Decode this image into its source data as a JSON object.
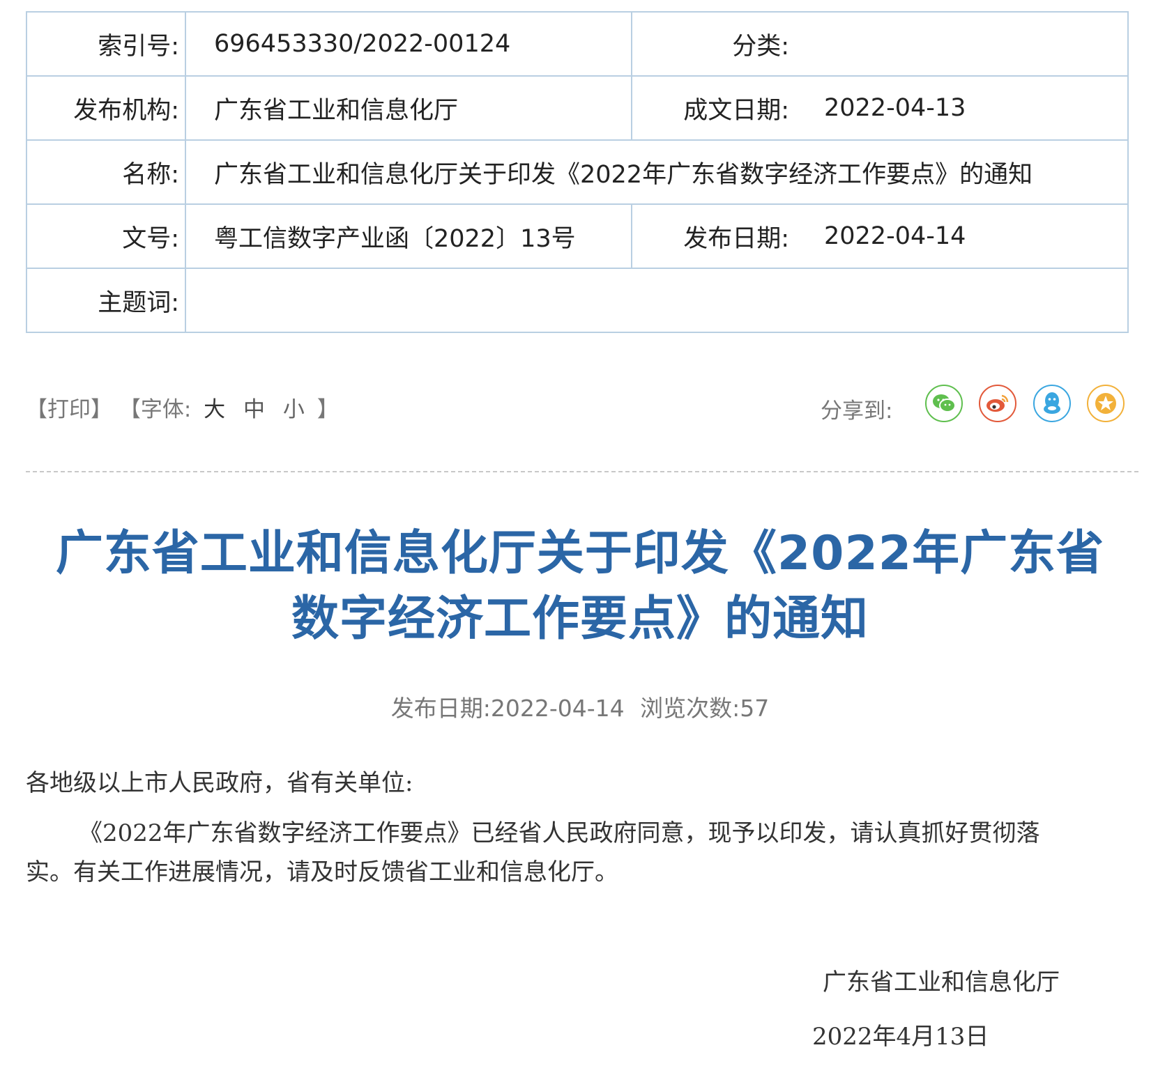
{
  "meta": {
    "index_label": "索引号:",
    "index_value": "696453330/2022-00124",
    "category_label": "分类:",
    "category_value": "",
    "issuer_label": "发布机构:",
    "issuer_value": "广东省工业和信息化厅",
    "written_date_label": "成文日期:",
    "written_date_value": "2022-04-13",
    "name_label": "名称:",
    "name_value": "广东省工业和信息化厅关于印发《2022年广东省数字经济工作要点》的通知",
    "doc_no_label": "文号:",
    "doc_no_value": "粤工信数字产业函〔2022〕13号",
    "publish_date_label": "发布日期:",
    "publish_date_value": "2022-04-14",
    "keywords_label": "主题词:",
    "keywords_value": ""
  },
  "toolbar": {
    "print": "【打印】",
    "font_open": "【字体:",
    "font_large": "大",
    "font_medium": "中",
    "font_small": "小",
    "font_close": "】",
    "share_label": "分享到:",
    "share_icons": [
      "wechat-icon",
      "weibo-icon",
      "qq-icon",
      "favorite-icon"
    ],
    "colors": {
      "wechat": "#5fbf4e",
      "weibo": "#e2593a",
      "qq": "#3aa6e0",
      "favorite": "#f2b13a"
    }
  },
  "article": {
    "title_line1": "广东省工业和信息化厅关于印发《2022年广东省",
    "title_line2": "数字经济工作要点》的通知",
    "title_color": "#2b66a6",
    "publish_info_label": "发布日期:",
    "publish_info_date": "2022-04-14",
    "views_label": "浏览次数:",
    "views_count": "57",
    "salutation": "各地级以上市人民政府，省有关单位:",
    "paragraph": "《2022年广东省数字经济工作要点》已经省人民政府同意，现予以印发，请认真抓好贯彻落实。有关工作进展情况，请及时反馈省工业和信息化厅。",
    "signature_org": "广东省工业和信息化厅",
    "signature_date": "2022年4月13日"
  }
}
